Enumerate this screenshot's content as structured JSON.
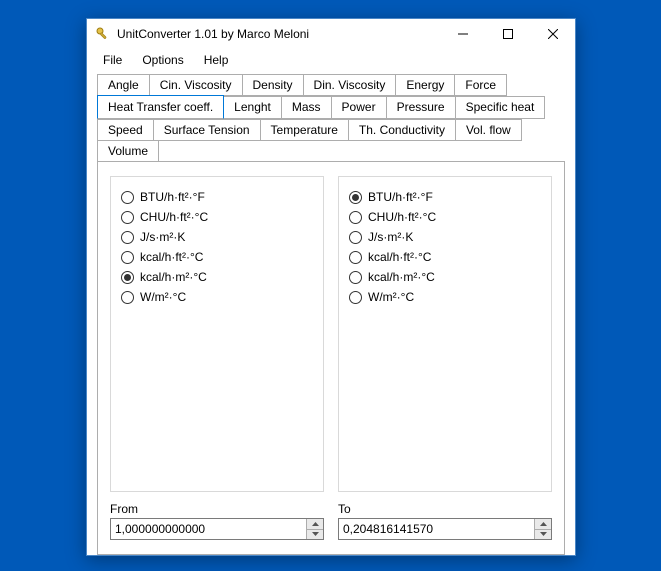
{
  "window": {
    "title": "UnitConverter 1.01 by Marco Meloni"
  },
  "menu": {
    "file": "File",
    "options": "Options",
    "help": "Help"
  },
  "tabs": {
    "row1": [
      "Angle",
      "Cin. Viscosity",
      "Density",
      "Din. Viscosity",
      "Energy",
      "Force"
    ],
    "row2": [
      "Heat Transfer coeff.",
      "Lenght",
      "Mass",
      "Power",
      "Pressure",
      "Specific heat"
    ],
    "row3": [
      "Speed",
      "Surface Tension",
      "Temperature",
      "Th. Conductivity",
      "Vol. flow"
    ],
    "row4": [
      "Volume"
    ],
    "selected": "Heat Transfer coeff."
  },
  "units": [
    "BTU/h·ft²·°F",
    "CHU/h·ft²·°C",
    "J/s·m²·K",
    "kcal/h·ft²·°C",
    "kcal/h·m²·°C",
    "W/m²·°C"
  ],
  "from_selected_index": 4,
  "to_selected_index": 0,
  "fields": {
    "from_label": "From",
    "to_label": "To",
    "from_value": "1,000000000000",
    "to_value": "0,204816141570"
  }
}
